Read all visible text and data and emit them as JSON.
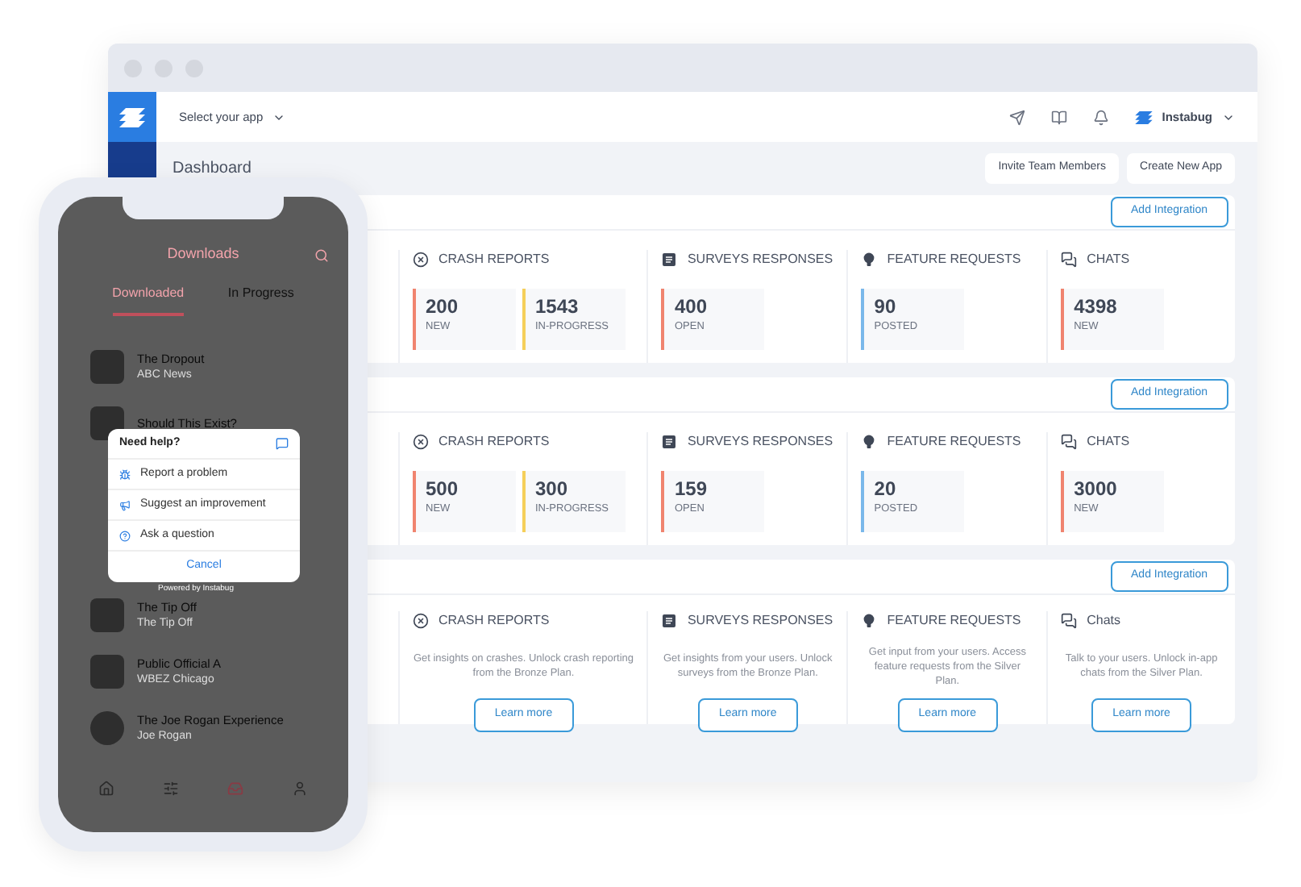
{
  "header": {
    "app_select": "Select your app",
    "account": "Instabug"
  },
  "page": {
    "title": "Dashboard",
    "buttons": [
      "Invite Team Members",
      "Create New App"
    ]
  },
  "sections": [
    {
      "button": "Add Integration",
      "columns": [
        {
          "kind": "stats",
          "title": "CRASH REPORTS",
          "stats": [
            {
              "value": "200",
              "label": "NEW",
              "color": "#f0846f"
            },
            {
              "value": "1543",
              "label": "IN-PROGRESS",
              "color": "#f5cf5a"
            }
          ]
        },
        {
          "kind": "stats",
          "title": "SURVEYS RESPONSES",
          "stats": [
            {
              "value": "400",
              "label": "OPEN",
              "color": "#f0846f"
            }
          ]
        },
        {
          "kind": "stats",
          "title": "FEATURE REQUESTS",
          "stats": [
            {
              "value": "90",
              "label": "POSTED",
              "color": "#7ab8ea"
            }
          ]
        },
        {
          "kind": "stats",
          "title": "CHATS",
          "stats": [
            {
              "value": "4398",
              "label": "NEW",
              "color": "#f0846f"
            }
          ]
        }
      ]
    },
    {
      "button": "Add Integration",
      "columns": [
        {
          "kind": "stats",
          "title": "CRASH REPORTS",
          "stats": [
            {
              "value": "500",
              "label": "NEW",
              "color": "#f0846f"
            },
            {
              "value": "300",
              "label": "IN-PROGRESS",
              "color": "#f5cf5a"
            }
          ]
        },
        {
          "kind": "stats",
          "title": "SURVEYS RESPONSES",
          "stats": [
            {
              "value": "159",
              "label": "OPEN",
              "color": "#f0846f"
            }
          ]
        },
        {
          "kind": "stats",
          "title": "FEATURE REQUESTS",
          "stats": [
            {
              "value": "20",
              "label": "POSTED",
              "color": "#7ab8ea"
            }
          ]
        },
        {
          "kind": "stats",
          "title": "CHATS",
          "stats": [
            {
              "value": "3000",
              "label": "NEW",
              "color": "#f0846f"
            }
          ]
        }
      ]
    },
    {
      "button": "Add Integration",
      "columns": [
        {
          "kind": "promo",
          "title": "CRASH REPORTS",
          "description": "Get insights on crashes. Unlock crash reporting from the Bronze Plan.",
          "action": "Learn more"
        },
        {
          "kind": "promo",
          "title": "SURVEYS RESPONSES",
          "description": "Get insights from your users. Unlock surveys from the Bronze Plan.",
          "action": "Learn more"
        },
        {
          "kind": "promo",
          "title": "FEATURE REQUESTS",
          "description": "Get input from your users. Access feature requests from the Silver Plan.",
          "action": "Learn more"
        },
        {
          "kind": "promo",
          "title": "Chats",
          "description": "Talk to your users. Unlock in-app chats from the Silver Plan.",
          "action": "Learn more"
        }
      ]
    }
  ],
  "phone": {
    "title": "Downloads",
    "tabs": [
      {
        "label": "Downloaded",
        "selected": true
      },
      {
        "label": "In Progress",
        "selected": false
      }
    ],
    "episodes": [
      {
        "title": "The Dropout",
        "show": "ABC News"
      },
      {
        "title": "Should This Exist?"
      },
      {
        "title": "The Tip Off",
        "show": "The Tip Off"
      },
      {
        "title": "Public Official A",
        "show": "WBEZ Chicago"
      },
      {
        "title": "The Joe Rogan Experience",
        "show": "Joe Rogan"
      }
    ],
    "help_sheet": {
      "title": "Need help?",
      "options": [
        {
          "label": "Report a problem"
        },
        {
          "label": "Suggest an improvement"
        },
        {
          "label": "Ask a question"
        }
      ],
      "cancel": "Cancel",
      "footer": "Powered by Instabug"
    },
    "nav": [
      {
        "selected": false
      },
      {
        "selected": false
      },
      {
        "selected": true
      },
      {
        "selected": false
      }
    ]
  }
}
